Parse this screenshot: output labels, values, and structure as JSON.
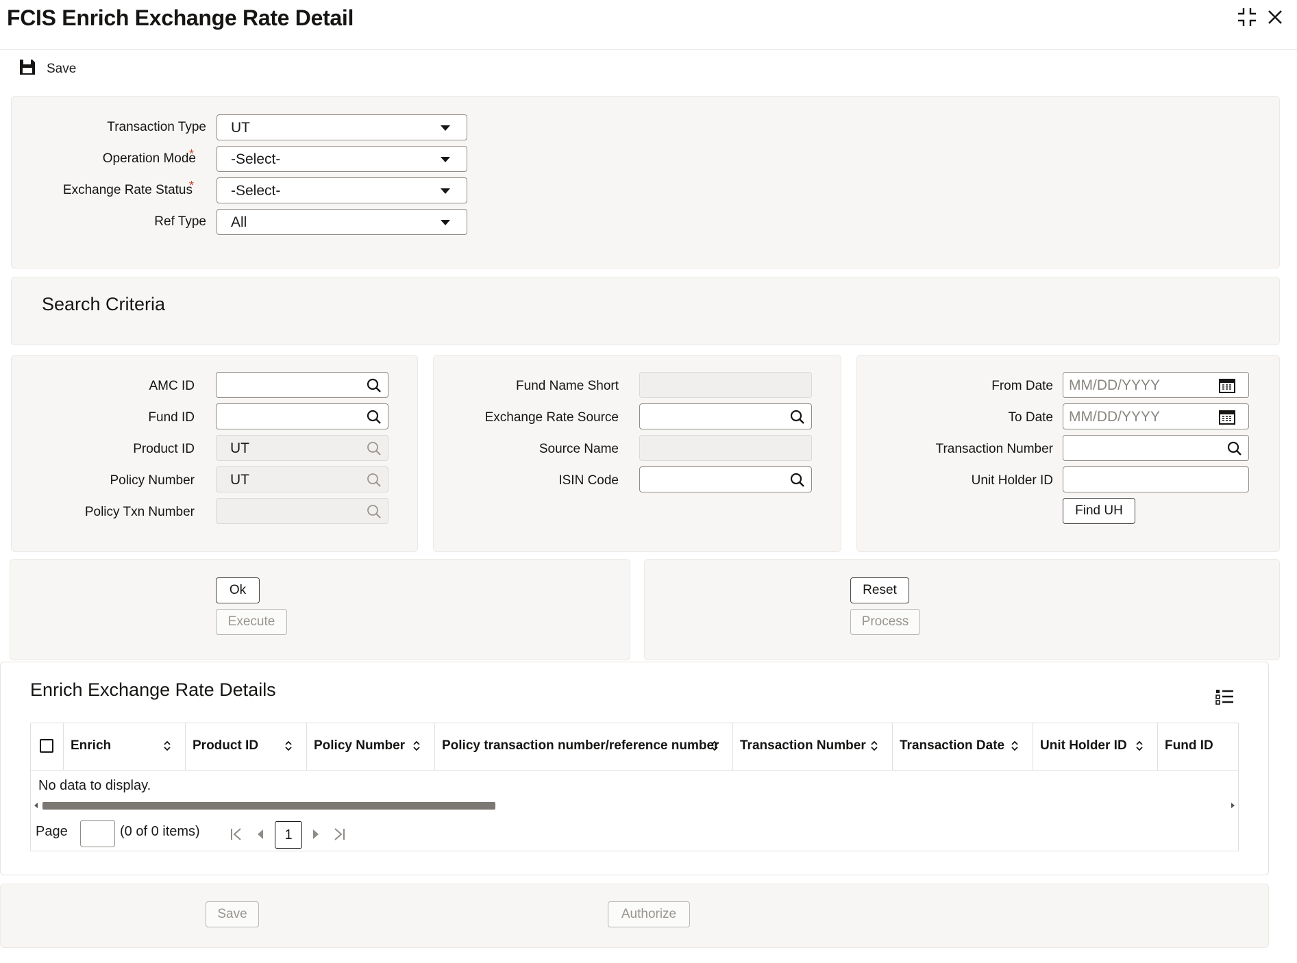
{
  "window": {
    "title": "FCIS Enrich Exchange Rate Detail"
  },
  "toolbar": {
    "save_label": "Save"
  },
  "top_form": {
    "transaction_type": {
      "label": "Transaction Type",
      "value": "UT"
    },
    "operation_mode": {
      "label": "Operation Mode",
      "value": "-Select-",
      "required_mark": "*"
    },
    "exchange_rate_status": {
      "label": "Exchange Rate Status",
      "value": "-Select-",
      "required_mark": "*"
    },
    "ref_type": {
      "label": "Ref Type",
      "value": "All"
    }
  },
  "search_criteria": {
    "title": "Search Criteria",
    "amc_id": {
      "label": "AMC ID",
      "value": ""
    },
    "fund_id": {
      "label": "Fund ID",
      "value": ""
    },
    "product_id": {
      "label": "Product ID",
      "value": "UT"
    },
    "policy_number": {
      "label": "Policy Number",
      "value": "UT"
    },
    "policy_txn_number": {
      "label": "Policy Txn Number",
      "value": ""
    },
    "fund_name_short": {
      "label": "Fund Name Short",
      "value": ""
    },
    "exchange_rate_source": {
      "label": "Exchange Rate Source",
      "value": ""
    },
    "source_name": {
      "label": "Source Name",
      "value": ""
    },
    "isin_code": {
      "label": "ISIN Code",
      "value": ""
    },
    "from_date": {
      "label": "From Date",
      "placeholder": "MM/DD/YYYY"
    },
    "to_date": {
      "label": "To Date",
      "placeholder": "MM/DD/YYYY"
    },
    "transaction_number": {
      "label": "Transaction Number",
      "value": ""
    },
    "unit_holder_id": {
      "label": "Unit Holder ID",
      "value": ""
    },
    "find_uh_label": "Find UH"
  },
  "actions": {
    "ok": "Ok",
    "execute": "Execute",
    "reset": "Reset",
    "process": "Process"
  },
  "details": {
    "title": "Enrich Exchange Rate Details",
    "columns": [
      "Enrich",
      "Product ID",
      "Policy Number",
      "Policy transaction number/reference number",
      "Transaction Number",
      "Transaction Date",
      "Unit Holder ID",
      "Fund ID"
    ],
    "empty_message": "No data to display.",
    "pagination": {
      "page_label": "Page",
      "items_text": "(0 of 0 items)",
      "current_page": "1"
    }
  },
  "footer": {
    "save": "Save",
    "authorize": "Authorize"
  }
}
